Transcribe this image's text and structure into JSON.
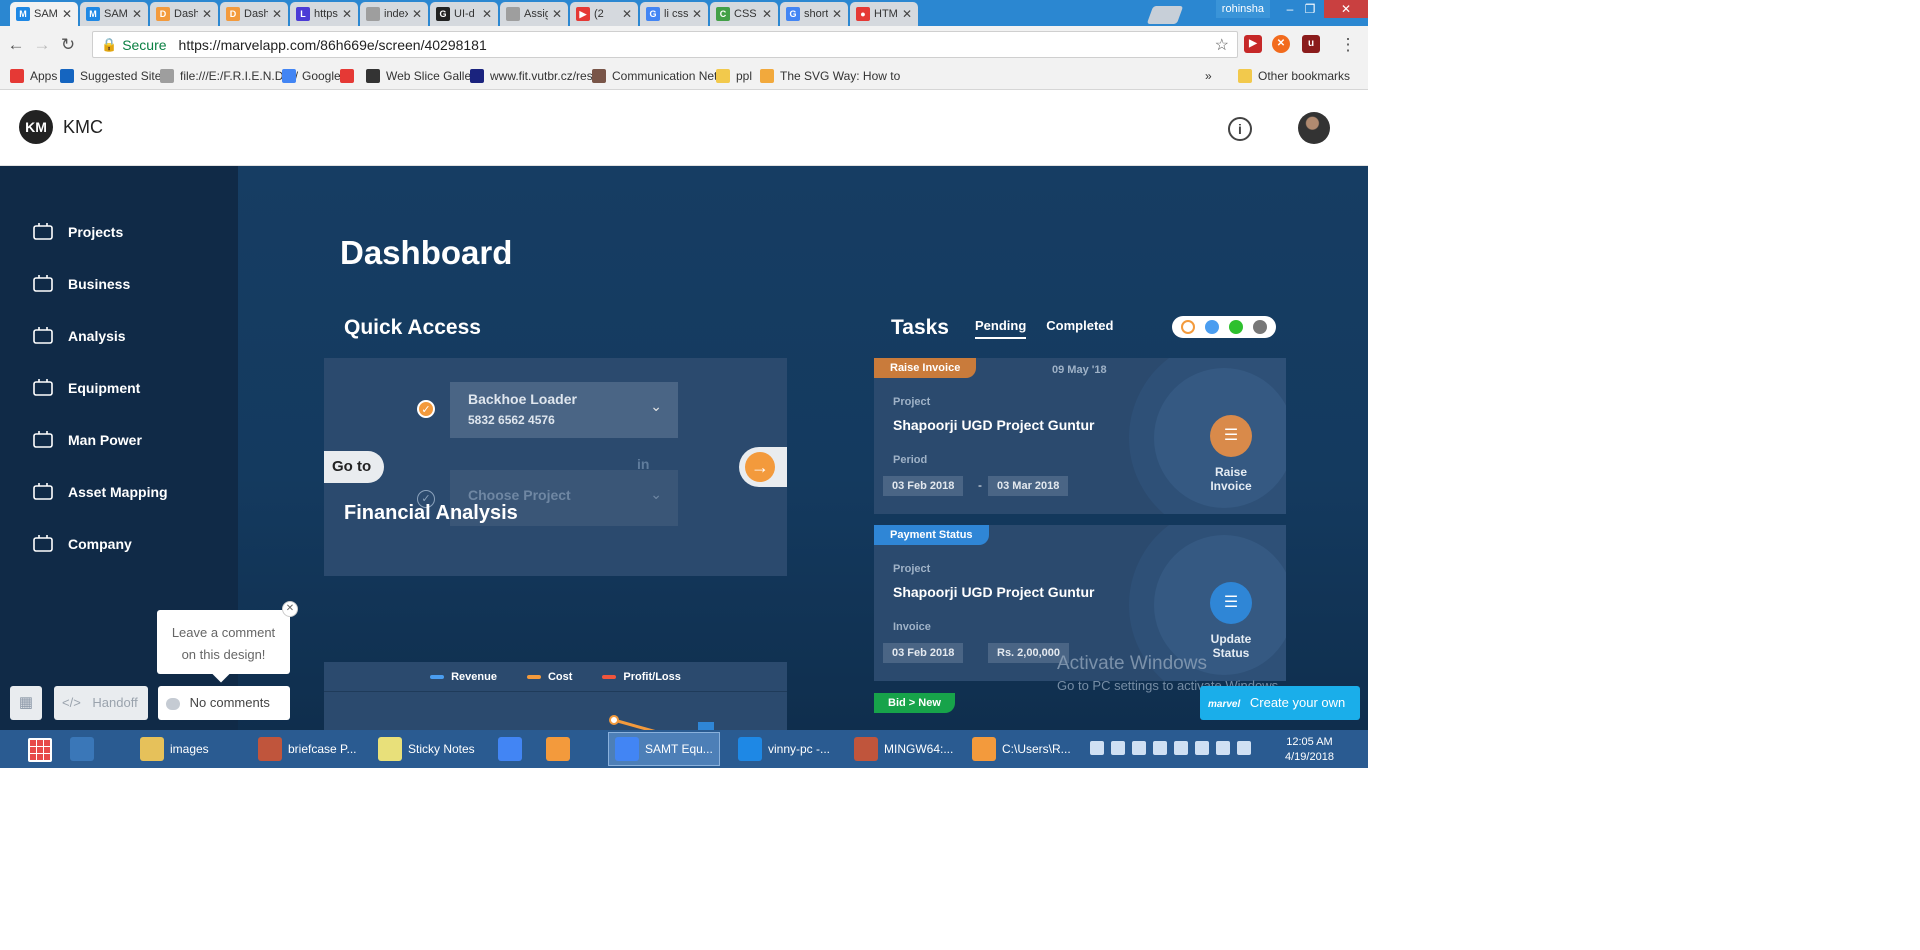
{
  "browser": {
    "tabs": [
      {
        "title": "SAM",
        "color": "#1e88e5",
        "glyph": "M"
      },
      {
        "title": "SAM",
        "color": "#1e88e5",
        "glyph": "M"
      },
      {
        "title": "Dash",
        "color": "#f39a3c",
        "glyph": "D"
      },
      {
        "title": "Dash",
        "color": "#f39a3c",
        "glyph": "D"
      },
      {
        "title": "https",
        "color": "#4b3bd6",
        "glyph": "L"
      },
      {
        "title": "index",
        "color": "#9e9e9e",
        "glyph": ""
      },
      {
        "title": "UI-d",
        "color": "#222222",
        "glyph": "G"
      },
      {
        "title": "Assig",
        "color": "#9e9e9e",
        "glyph": ""
      },
      {
        "title": "(2",
        "color": "#e53935",
        "glyph": "▶"
      },
      {
        "title": "li css",
        "color": "#4285f4",
        "glyph": "G"
      },
      {
        "title": "CSS",
        "color": "#43a047",
        "glyph": "C"
      },
      {
        "title": "short",
        "color": "#4285f4",
        "glyph": "G"
      },
      {
        "title": "HTM",
        "color": "#e53935",
        "glyph": "●"
      }
    ],
    "user_label": "rohinsha",
    "secure_label": "Secure",
    "url": "https://marvelapp.com/86h669e/screen/40298181",
    "bookmarks": [
      {
        "label": "Apps",
        "color": "#e53935"
      },
      {
        "label": "Suggested Sites",
        "color": "#1565c0"
      },
      {
        "label": "file:///E:/F.R.I.E.N.D.S/",
        "color": "#9e9e9e"
      },
      {
        "label": "Google",
        "color": "#4285f4"
      },
      {
        "label": "",
        "color": "#e53935"
      },
      {
        "label": "Web Slice Gallery",
        "color": "#333333"
      },
      {
        "label": "www.fit.vutbr.cz/rese",
        "color": "#1a237e"
      },
      {
        "label": "Communication Netw",
        "color": "#795548"
      },
      {
        "label": "ppl",
        "color": "#f2c94c"
      },
      {
        "label": "The SVG Way: How to",
        "color": "#f2a93c"
      }
    ],
    "bookmarks_overflow": "»",
    "other_bookmarks": "Other bookmarks"
  },
  "app": {
    "logo": "KM",
    "brand": "KMC",
    "sidebar": [
      {
        "label": "Projects",
        "icon": "briefcase-icon"
      },
      {
        "label": "Business",
        "icon": "money-bag-icon"
      },
      {
        "label": "Analysis",
        "icon": "chart-icon"
      },
      {
        "label": "Equipment",
        "icon": "equipment-icon"
      },
      {
        "label": "Man Power",
        "icon": "helmet-icon"
      },
      {
        "label": "Asset Mapping",
        "icon": "map-pin-icon"
      },
      {
        "label": "Company",
        "icon": "org-chart-icon"
      }
    ],
    "page_title": "Dashboard",
    "quick_access": {
      "title": "Quick Access",
      "goto_label": "Go to",
      "selected_title": "Backhoe Loader",
      "selected_sub": "5832 6562 4576",
      "in_label": "in",
      "choose_placeholder": "Choose Project"
    },
    "financial": {
      "title": "Financial Analysis",
      "legend": [
        {
          "name": "Revenue",
          "color": "#4a9df0"
        },
        {
          "name": "Cost",
          "color": "#f39a3c"
        },
        {
          "name": "Profit/Loss",
          "color": "#f0553c"
        }
      ]
    },
    "tasks": {
      "title": "Tasks",
      "tabs": [
        "Pending",
        "Completed"
      ],
      "filter_colors": [
        "#f39a3c",
        "#4a9df0",
        "#2ec02e",
        "#777777"
      ],
      "cards": [
        {
          "tag": "Raise Invoice",
          "tag_color": "#c97b3b",
          "date": "09 May '18",
          "project_label": "Project",
          "project": "Shapoorji UGD Project Guntur",
          "meta_label": "Period",
          "pill1": "03 Feb 2018",
          "separator": "-",
          "pill2": "03 Mar 2018",
          "action": "Raise Invoice",
          "action_color": "#d98a4a"
        },
        {
          "tag": "Payment Status",
          "tag_color": "#2f86d6",
          "date": "",
          "project_label": "Project",
          "project": "Shapoorji UGD Project Guntur",
          "meta_label": "Invoice",
          "pill1": "03 Feb 2018",
          "separator": "",
          "pill2": "Rs. 2,00,000",
          "action": "Update Status",
          "action_color": "#2f86d6"
        }
      ],
      "bid_tag": "Bid > New"
    }
  },
  "marvel": {
    "comment_prompt": "Leave a comment on this design!",
    "handoff": "Handoff",
    "no_comments": "No comments",
    "create_logo": "marvel",
    "create_own": "Create your own"
  },
  "watermark": {
    "line1": "Activate Windows",
    "line2": "Go to PC settings to activate Windows."
  },
  "taskbar": {
    "items": [
      {
        "label": "",
        "color": "#3a77b8"
      },
      {
        "label": "images",
        "color": "#e6c15a"
      },
      {
        "label": "briefcase P...",
        "color": "#c0553c"
      },
      {
        "label": "Sticky Notes",
        "color": "#e8e07a"
      },
      {
        "label": "",
        "color": "#4285f4"
      },
      {
        "label": "",
        "color": "#f39a3c"
      },
      {
        "label": "SAMT Equ...",
        "color": "#4285f4"
      },
      {
        "label": "vinny-pc -...",
        "color": "#1e88e5"
      },
      {
        "label": "MINGW64:...",
        "color": "#c0553c"
      },
      {
        "label": "C:\\Users\\R...",
        "color": "#f39a3c"
      }
    ],
    "time": "12:05 AM",
    "date": "4/19/2018"
  }
}
